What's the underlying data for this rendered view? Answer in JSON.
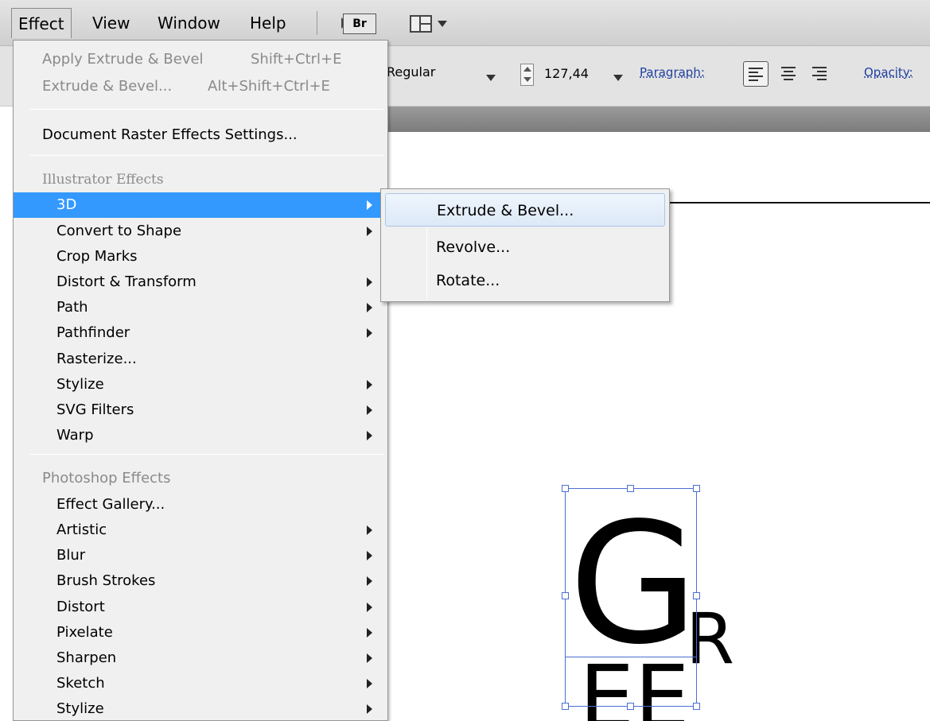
{
  "menubar": {
    "items": [
      "Effect",
      "View",
      "Window",
      "Help"
    ],
    "bridge_label": "Br"
  },
  "control_bar": {
    "font_style": "Regular",
    "font_size": "127,44",
    "paragraph_label": "Paragraph:",
    "opacity_label": "Opacity:"
  },
  "effect_menu": {
    "apply_label": "Apply Extrude & Bevel",
    "apply_shortcut": "Shift+Ctrl+E",
    "last_label": "Extrude & Bevel...",
    "last_shortcut": "Alt+Shift+Ctrl+E",
    "raster_settings": "Document Raster Effects Settings...",
    "illustrator_header": "Illustrator Effects",
    "illustrator_items": [
      "3D",
      "Convert to Shape",
      "Crop Marks",
      "Distort & Transform",
      "Path",
      "Pathfinder",
      "Rasterize...",
      "Stylize",
      "SVG Filters",
      "Warp"
    ],
    "photoshop_header": "Photoshop Effects",
    "photoshop_items": [
      "Effect Gallery...",
      "Artistic",
      "Blur",
      "Brush Strokes",
      "Distort",
      "Pixelate",
      "Sharpen",
      "Sketch",
      "Stylize"
    ]
  },
  "submenu_3d": {
    "items": [
      "Extrude & Bevel...",
      "Revolve...",
      "Rotate..."
    ]
  },
  "artwork": {
    "glyph_g": "G",
    "glyph_r": "R",
    "glyph_e": "EE"
  },
  "colors": {
    "menu_highlight": "#3399ff",
    "selection": "#4a6fd1"
  }
}
